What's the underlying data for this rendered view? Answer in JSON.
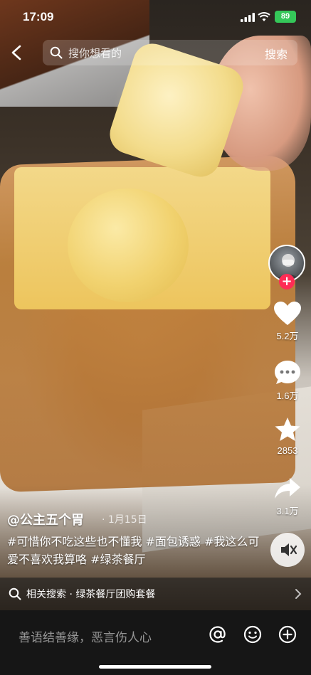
{
  "status_bar": {
    "time": "17:09",
    "battery": "89"
  },
  "search": {
    "placeholder": "搜你想看的",
    "button_label": "搜索"
  },
  "actions": {
    "likes": "5.2万",
    "comments": "1.6万",
    "favorites": "2853",
    "shares": "3.1万"
  },
  "post": {
    "author": "@公主五个胃",
    "date": "· 1月15日",
    "caption": "#可惜你不吃这些也不懂我 #面包诱惑 #我这么可爱不喜欢我算咯 #绿茶餐厅"
  },
  "related_search": {
    "label": "相关搜索 · 绿茶餐厅团购套餐"
  },
  "comment_bar": {
    "placeholder": "善语结善缘，恶言伤人心"
  },
  "icons": {
    "back": "back-arrow-icon",
    "search": "search-icon",
    "like": "heart-icon",
    "comment": "comment-bubble-icon",
    "favorite": "star-icon",
    "share": "share-arrow-icon",
    "mute": "speaker-muted-icon",
    "at": "at-sign-icon",
    "emoji": "emoji-icon",
    "add": "plus-circle-icon"
  },
  "colors": {
    "follow": "#fe2c55",
    "battery": "#35c759"
  }
}
